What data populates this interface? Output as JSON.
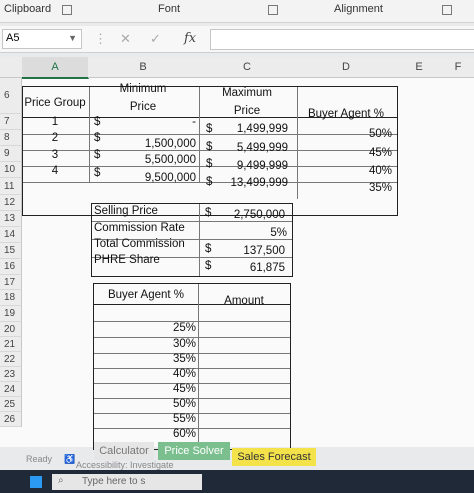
{
  "ribbon": {
    "clipboard": "Clipboard",
    "font": "Font",
    "alignment": "Alignment"
  },
  "formula_bar": {
    "name_box": "A5",
    "fx": "fx",
    "cancel": "✕",
    "enter": "✓"
  },
  "columns": [
    "A",
    "B",
    "C",
    "D",
    "E",
    "F"
  ],
  "rows": [
    "6",
    "7",
    "8",
    "9",
    "10",
    "11",
    "12",
    "13",
    "14",
    "15",
    "16",
    "17",
    "18",
    "19",
    "20",
    "21",
    "22",
    "23",
    "24",
    "25",
    "26"
  ],
  "table1": {
    "header_a": "Price Group",
    "header_b_line1": "Minimum",
    "header_b_line2": "Price",
    "header_c_line1": "Maximum",
    "header_c_line2": "Price",
    "header_d": "Buyer Agent %",
    "currency": "$",
    "rows": [
      {
        "group": "1",
        "min": "-",
        "max": "1,499,999",
        "pct": "50%"
      },
      {
        "group": "2",
        "min": "1,500,000",
        "max": "5,499,999",
        "pct": "45%"
      },
      {
        "group": "3",
        "min": "5,500,000",
        "max": "9,499,999",
        "pct": "40%"
      },
      {
        "group": "4",
        "min": "9,500,000",
        "max": "13,499,999",
        "pct": "35%"
      }
    ]
  },
  "table2": {
    "rows": [
      {
        "label": "Selling Price",
        "currency": "$",
        "value": "2,750,000"
      },
      {
        "label": "Commission Rate",
        "currency": "",
        "value": "5%"
      },
      {
        "label": "Total Commission",
        "currency": "$",
        "value": "137,500"
      },
      {
        "label": "PHRE Share",
        "currency": "$",
        "value": "61,875"
      }
    ]
  },
  "table3": {
    "header_pct": "Buyer Agent %",
    "header_amount": "Amount",
    "pcts": [
      "25%",
      "30%",
      "35%",
      "40%",
      "45%",
      "50%",
      "55%",
      "60%"
    ]
  },
  "tabs": {
    "calculator": "Calculator",
    "price_solver": "Price Solver",
    "sales_forecast": "Sales Forecast"
  },
  "status": {
    "ready": "Ready",
    "accessibility": "Accessibility: Investigate"
  },
  "taskbar": {
    "search_placeholder": "Type here to s"
  }
}
